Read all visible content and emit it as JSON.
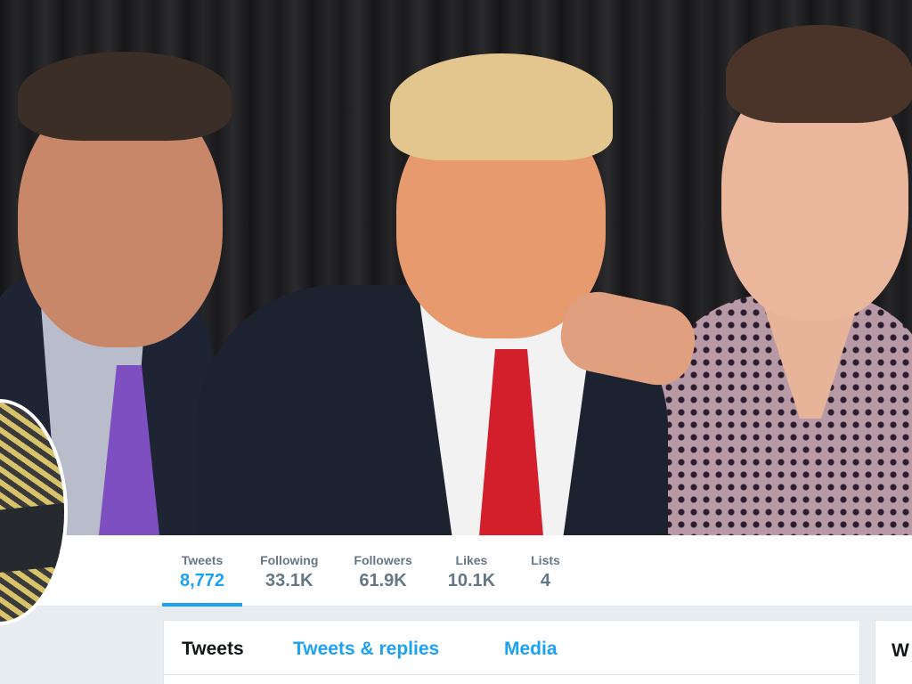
{
  "header": {
    "photo_icon": "header-photo"
  },
  "avatar": {
    "icon": "avatar-image"
  },
  "stats": [
    {
      "label": "Tweets",
      "value": "8,772",
      "active": true
    },
    {
      "label": "Following",
      "value": "33.1K"
    },
    {
      "label": "Followers",
      "value": "61.9K"
    },
    {
      "label": "Likes",
      "value": "10.1K"
    },
    {
      "label": "Lists",
      "value": "4"
    }
  ],
  "timeline_tabs": {
    "tweets": "Tweets",
    "replies": "Tweets & replies",
    "media": "Media"
  },
  "sidebar": {
    "title": "W"
  },
  "colors": {
    "accent": "#1da1f2",
    "muted": "#657786",
    "text": "#14171a",
    "background": "#e6ecf0"
  }
}
